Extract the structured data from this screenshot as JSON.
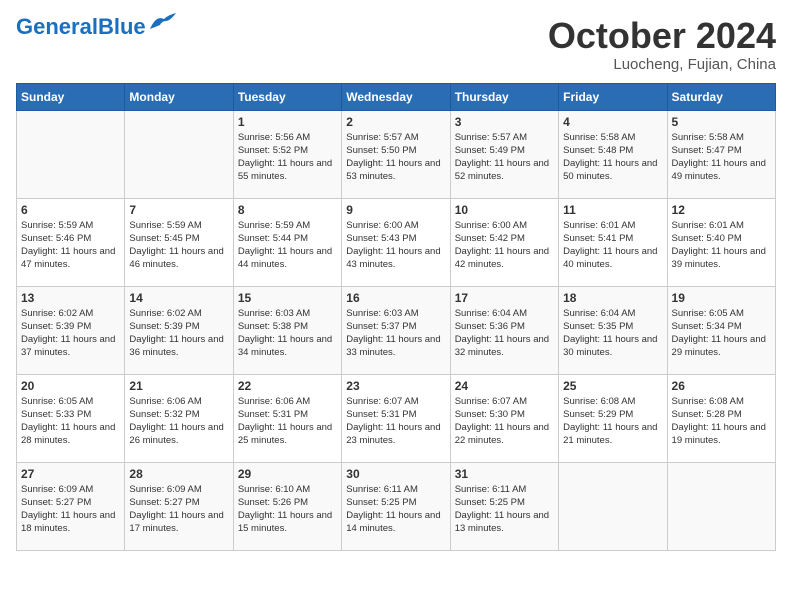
{
  "header": {
    "logo_general": "General",
    "logo_blue": "Blue",
    "month_title": "October 2024",
    "location": "Luocheng, Fujian, China"
  },
  "weekdays": [
    "Sunday",
    "Monday",
    "Tuesday",
    "Wednesday",
    "Thursday",
    "Friday",
    "Saturday"
  ],
  "weeks": [
    [
      {
        "day": "",
        "sunrise": "",
        "sunset": "",
        "daylight": ""
      },
      {
        "day": "",
        "sunrise": "",
        "sunset": "",
        "daylight": ""
      },
      {
        "day": "1",
        "sunrise": "Sunrise: 5:56 AM",
        "sunset": "Sunset: 5:52 PM",
        "daylight": "Daylight: 11 hours and 55 minutes."
      },
      {
        "day": "2",
        "sunrise": "Sunrise: 5:57 AM",
        "sunset": "Sunset: 5:50 PM",
        "daylight": "Daylight: 11 hours and 53 minutes."
      },
      {
        "day": "3",
        "sunrise": "Sunrise: 5:57 AM",
        "sunset": "Sunset: 5:49 PM",
        "daylight": "Daylight: 11 hours and 52 minutes."
      },
      {
        "day": "4",
        "sunrise": "Sunrise: 5:58 AM",
        "sunset": "Sunset: 5:48 PM",
        "daylight": "Daylight: 11 hours and 50 minutes."
      },
      {
        "day": "5",
        "sunrise": "Sunrise: 5:58 AM",
        "sunset": "Sunset: 5:47 PM",
        "daylight": "Daylight: 11 hours and 49 minutes."
      }
    ],
    [
      {
        "day": "6",
        "sunrise": "Sunrise: 5:59 AM",
        "sunset": "Sunset: 5:46 PM",
        "daylight": "Daylight: 11 hours and 47 minutes."
      },
      {
        "day": "7",
        "sunrise": "Sunrise: 5:59 AM",
        "sunset": "Sunset: 5:45 PM",
        "daylight": "Daylight: 11 hours and 46 minutes."
      },
      {
        "day": "8",
        "sunrise": "Sunrise: 5:59 AM",
        "sunset": "Sunset: 5:44 PM",
        "daylight": "Daylight: 11 hours and 44 minutes."
      },
      {
        "day": "9",
        "sunrise": "Sunrise: 6:00 AM",
        "sunset": "Sunset: 5:43 PM",
        "daylight": "Daylight: 11 hours and 43 minutes."
      },
      {
        "day": "10",
        "sunrise": "Sunrise: 6:00 AM",
        "sunset": "Sunset: 5:42 PM",
        "daylight": "Daylight: 11 hours and 42 minutes."
      },
      {
        "day": "11",
        "sunrise": "Sunrise: 6:01 AM",
        "sunset": "Sunset: 5:41 PM",
        "daylight": "Daylight: 11 hours and 40 minutes."
      },
      {
        "day": "12",
        "sunrise": "Sunrise: 6:01 AM",
        "sunset": "Sunset: 5:40 PM",
        "daylight": "Daylight: 11 hours and 39 minutes."
      }
    ],
    [
      {
        "day": "13",
        "sunrise": "Sunrise: 6:02 AM",
        "sunset": "Sunset: 5:39 PM",
        "daylight": "Daylight: 11 hours and 37 minutes."
      },
      {
        "day": "14",
        "sunrise": "Sunrise: 6:02 AM",
        "sunset": "Sunset: 5:39 PM",
        "daylight": "Daylight: 11 hours and 36 minutes."
      },
      {
        "day": "15",
        "sunrise": "Sunrise: 6:03 AM",
        "sunset": "Sunset: 5:38 PM",
        "daylight": "Daylight: 11 hours and 34 minutes."
      },
      {
        "day": "16",
        "sunrise": "Sunrise: 6:03 AM",
        "sunset": "Sunset: 5:37 PM",
        "daylight": "Daylight: 11 hours and 33 minutes."
      },
      {
        "day": "17",
        "sunrise": "Sunrise: 6:04 AM",
        "sunset": "Sunset: 5:36 PM",
        "daylight": "Daylight: 11 hours and 32 minutes."
      },
      {
        "day": "18",
        "sunrise": "Sunrise: 6:04 AM",
        "sunset": "Sunset: 5:35 PM",
        "daylight": "Daylight: 11 hours and 30 minutes."
      },
      {
        "day": "19",
        "sunrise": "Sunrise: 6:05 AM",
        "sunset": "Sunset: 5:34 PM",
        "daylight": "Daylight: 11 hours and 29 minutes."
      }
    ],
    [
      {
        "day": "20",
        "sunrise": "Sunrise: 6:05 AM",
        "sunset": "Sunset: 5:33 PM",
        "daylight": "Daylight: 11 hours and 28 minutes."
      },
      {
        "day": "21",
        "sunrise": "Sunrise: 6:06 AM",
        "sunset": "Sunset: 5:32 PM",
        "daylight": "Daylight: 11 hours and 26 minutes."
      },
      {
        "day": "22",
        "sunrise": "Sunrise: 6:06 AM",
        "sunset": "Sunset: 5:31 PM",
        "daylight": "Daylight: 11 hours and 25 minutes."
      },
      {
        "day": "23",
        "sunrise": "Sunrise: 6:07 AM",
        "sunset": "Sunset: 5:31 PM",
        "daylight": "Daylight: 11 hours and 23 minutes."
      },
      {
        "day": "24",
        "sunrise": "Sunrise: 6:07 AM",
        "sunset": "Sunset: 5:30 PM",
        "daylight": "Daylight: 11 hours and 22 minutes."
      },
      {
        "day": "25",
        "sunrise": "Sunrise: 6:08 AM",
        "sunset": "Sunset: 5:29 PM",
        "daylight": "Daylight: 11 hours and 21 minutes."
      },
      {
        "day": "26",
        "sunrise": "Sunrise: 6:08 AM",
        "sunset": "Sunset: 5:28 PM",
        "daylight": "Daylight: 11 hours and 19 minutes."
      }
    ],
    [
      {
        "day": "27",
        "sunrise": "Sunrise: 6:09 AM",
        "sunset": "Sunset: 5:27 PM",
        "daylight": "Daylight: 11 hours and 18 minutes."
      },
      {
        "day": "28",
        "sunrise": "Sunrise: 6:09 AM",
        "sunset": "Sunset: 5:27 PM",
        "daylight": "Daylight: 11 hours and 17 minutes."
      },
      {
        "day": "29",
        "sunrise": "Sunrise: 6:10 AM",
        "sunset": "Sunset: 5:26 PM",
        "daylight": "Daylight: 11 hours and 15 minutes."
      },
      {
        "day": "30",
        "sunrise": "Sunrise: 6:11 AM",
        "sunset": "Sunset: 5:25 PM",
        "daylight": "Daylight: 11 hours and 14 minutes."
      },
      {
        "day": "31",
        "sunrise": "Sunrise: 6:11 AM",
        "sunset": "Sunset: 5:25 PM",
        "daylight": "Daylight: 11 hours and 13 minutes."
      },
      {
        "day": "",
        "sunrise": "",
        "sunset": "",
        "daylight": ""
      },
      {
        "day": "",
        "sunrise": "",
        "sunset": "",
        "daylight": ""
      }
    ]
  ]
}
